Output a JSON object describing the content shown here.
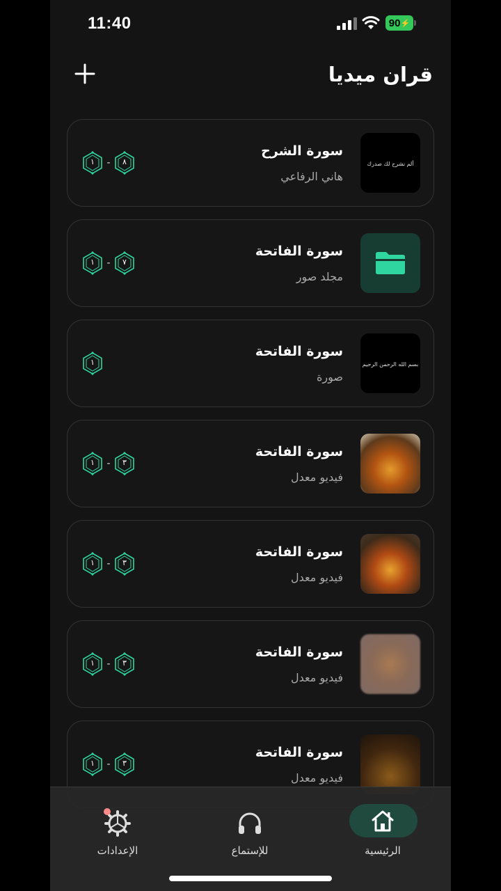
{
  "status_bar": {
    "time": "11:40",
    "battery": "90"
  },
  "header": {
    "title": "قران ميديا",
    "add_icon": "plus-icon"
  },
  "colors": {
    "accent": "#2fd6a0",
    "background": "#141414",
    "card_border": "#333333",
    "nav_active": "#1f4a3d"
  },
  "items": [
    {
      "title": "سورة الشرح",
      "subtitle": "هاني الرفاعي",
      "thumb": "black",
      "thumb_caption": "ألم نشرح لك صدرك",
      "range_start": "١",
      "range_end": "٨"
    },
    {
      "title": "سورة الفاتحة",
      "subtitle": "مجلد صور",
      "thumb": "folder",
      "thumb_caption": "",
      "range_start": "١",
      "range_end": "٧"
    },
    {
      "title": "سورة الفاتحة",
      "subtitle": "صورة",
      "thumb": "black",
      "thumb_caption": "بسم الله الرحمن الرحيم",
      "range_start": "١",
      "range_end": ""
    },
    {
      "title": "سورة الفاتحة",
      "subtitle": "فيديو معدل",
      "thumb": "video1",
      "thumb_caption": "",
      "range_start": "١",
      "range_end": "٣"
    },
    {
      "title": "سورة الفاتحة",
      "subtitle": "فيديو معدل",
      "thumb": "video2",
      "thumb_caption": "",
      "range_start": "١",
      "range_end": "٣"
    },
    {
      "title": "سورة الفاتحة",
      "subtitle": "فيديو معدل",
      "thumb": "blur",
      "thumb_caption": "",
      "range_start": "١",
      "range_end": "٣"
    },
    {
      "title": "سورة الفاتحة",
      "subtitle": "فيديو معدل",
      "thumb": "dark",
      "thumb_caption": "",
      "range_start": "١",
      "range_end": "٣"
    }
  ],
  "nav": {
    "home": {
      "label": "الرئيسية",
      "icon": "home-icon",
      "active": true
    },
    "listen": {
      "label": "للإستماع",
      "icon": "headphones-icon"
    },
    "settings": {
      "label": "الإعدادات",
      "icon": "gear-icon"
    }
  }
}
